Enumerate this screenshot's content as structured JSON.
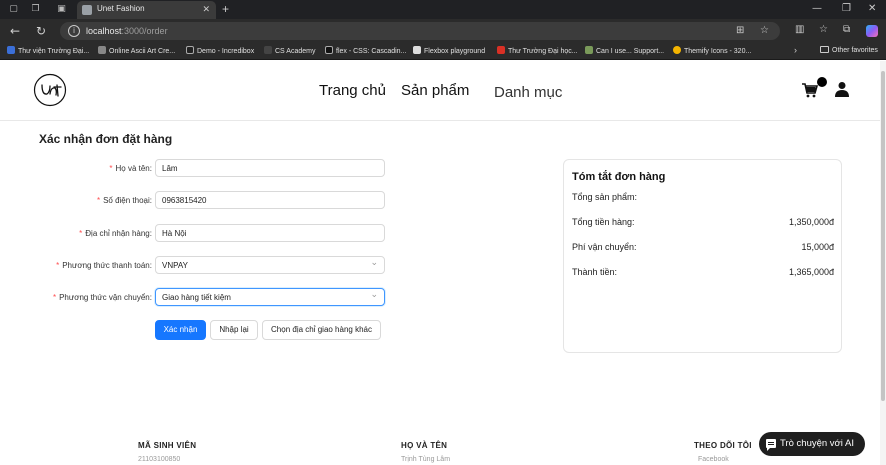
{
  "browser": {
    "tab_title": "Unet Fashion",
    "url_host": "localhost",
    "url_path": ":3000/order",
    "bookmarks": [
      "Thư viện Trường Đại...",
      "Online Ascii Art Cre...",
      "Demo - Incredibox",
      "CS Academy",
      "flex - CSS: Cascadin...",
      "Flexbox playground",
      "Thư Trường Đại học...",
      "Can I use... Support...",
      "Themify Icons - 320..."
    ],
    "other_favorites": "Other favorites"
  },
  "header": {
    "logo_text": "Unet",
    "nav": [
      "Trang chủ",
      "Sản phẩm",
      "Danh mục"
    ]
  },
  "form": {
    "title": "Xác nhận đơn đặt hàng",
    "fields": [
      {
        "label": "Họ và tên",
        "value": "Lâm"
      },
      {
        "label": "Số điện thoại",
        "value": "0963815420"
      },
      {
        "label": "Địa chỉ nhận hàng",
        "value": "Hà Nội"
      },
      {
        "label": "Phương thức thanh toán",
        "value": "VNPAY"
      },
      {
        "label": "Phương thức vận chuyển",
        "value": "Giao hàng tiết kiệm"
      }
    ],
    "buttons": {
      "confirm": "Xác nhận",
      "reset": "Nhập lại",
      "other_address": "Chọn địa chỉ giao hàng khác"
    }
  },
  "summary": {
    "title": "Tóm tắt đơn hàng",
    "rows": [
      {
        "label": "Tổng sản phẩm:",
        "value": ""
      },
      {
        "label": "Tổng tiền hàng:",
        "value": "1,350,000đ"
      },
      {
        "label": "Phí vận chuyển:",
        "value": "15,000đ"
      },
      {
        "label": "Thành tiền:",
        "value": "1,365,000đ"
      }
    ]
  },
  "footer": {
    "columns": [
      {
        "heading": "MÃ SINH VIÊN",
        "value": "21103100850"
      },
      {
        "heading": "HỌ VÀ TÊN",
        "value": "Trịnh Tùng Lâm"
      },
      {
        "heading": "THEO DÕI TÔI",
        "value": "Facebook"
      }
    ]
  },
  "chat": {
    "label": "Trò chuyện với AI"
  },
  "colors": {
    "primary": "#1677ff",
    "required": "#ff4d4f"
  }
}
